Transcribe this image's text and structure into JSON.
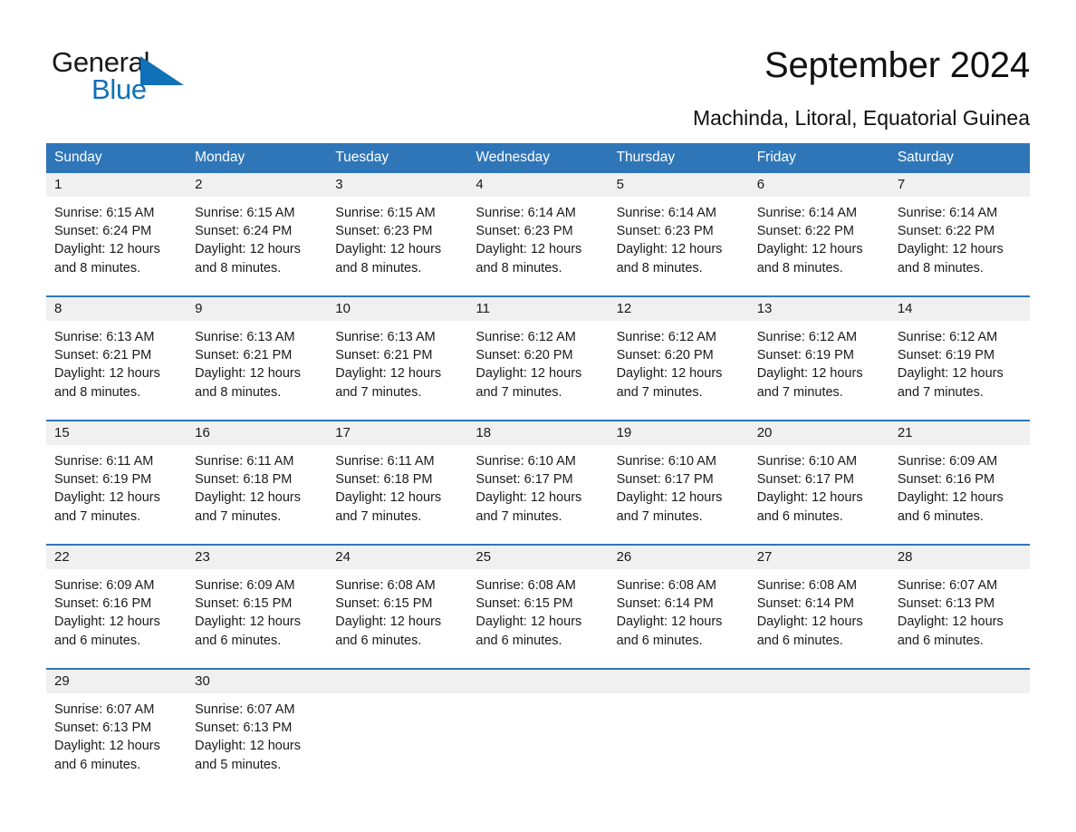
{
  "brand": {
    "name_part1": "General",
    "name_part2": "Blue",
    "logo_icon": "triangle-flag-icon",
    "accent_color": "#1070b8"
  },
  "header": {
    "title": "September 2024",
    "subtitle": "Machinda, Litoral, Equatorial Guinea"
  },
  "colors": {
    "header_blue": "#2f76b8",
    "day_band_gray": "#f0f0f0",
    "text": "#1a1a1a",
    "white": "#ffffff"
  },
  "weekdays": [
    "Sunday",
    "Monday",
    "Tuesday",
    "Wednesday",
    "Thursday",
    "Friday",
    "Saturday"
  ],
  "weeks": [
    {
      "days": [
        {
          "num": "1",
          "info": "Sunrise: 6:15 AM\nSunset: 6:24 PM\nDaylight: 12 hours and 8 minutes."
        },
        {
          "num": "2",
          "info": "Sunrise: 6:15 AM\nSunset: 6:24 PM\nDaylight: 12 hours and 8 minutes."
        },
        {
          "num": "3",
          "info": "Sunrise: 6:15 AM\nSunset: 6:23 PM\nDaylight: 12 hours and 8 minutes."
        },
        {
          "num": "4",
          "info": "Sunrise: 6:14 AM\nSunset: 6:23 PM\nDaylight: 12 hours and 8 minutes."
        },
        {
          "num": "5",
          "info": "Sunrise: 6:14 AM\nSunset: 6:23 PM\nDaylight: 12 hours and 8 minutes."
        },
        {
          "num": "6",
          "info": "Sunrise: 6:14 AM\nSunset: 6:22 PM\nDaylight: 12 hours and 8 minutes."
        },
        {
          "num": "7",
          "info": "Sunrise: 6:14 AM\nSunset: 6:22 PM\nDaylight: 12 hours and 8 minutes."
        }
      ]
    },
    {
      "days": [
        {
          "num": "8",
          "info": "Sunrise: 6:13 AM\nSunset: 6:21 PM\nDaylight: 12 hours and 8 minutes."
        },
        {
          "num": "9",
          "info": "Sunrise: 6:13 AM\nSunset: 6:21 PM\nDaylight: 12 hours and 8 minutes."
        },
        {
          "num": "10",
          "info": "Sunrise: 6:13 AM\nSunset: 6:21 PM\nDaylight: 12 hours and 7 minutes."
        },
        {
          "num": "11",
          "info": "Sunrise: 6:12 AM\nSunset: 6:20 PM\nDaylight: 12 hours and 7 minutes."
        },
        {
          "num": "12",
          "info": "Sunrise: 6:12 AM\nSunset: 6:20 PM\nDaylight: 12 hours and 7 minutes."
        },
        {
          "num": "13",
          "info": "Sunrise: 6:12 AM\nSunset: 6:19 PM\nDaylight: 12 hours and 7 minutes."
        },
        {
          "num": "14",
          "info": "Sunrise: 6:12 AM\nSunset: 6:19 PM\nDaylight: 12 hours and 7 minutes."
        }
      ]
    },
    {
      "days": [
        {
          "num": "15",
          "info": "Sunrise: 6:11 AM\nSunset: 6:19 PM\nDaylight: 12 hours and 7 minutes."
        },
        {
          "num": "16",
          "info": "Sunrise: 6:11 AM\nSunset: 6:18 PM\nDaylight: 12 hours and 7 minutes."
        },
        {
          "num": "17",
          "info": "Sunrise: 6:11 AM\nSunset: 6:18 PM\nDaylight: 12 hours and 7 minutes."
        },
        {
          "num": "18",
          "info": "Sunrise: 6:10 AM\nSunset: 6:17 PM\nDaylight: 12 hours and 7 minutes."
        },
        {
          "num": "19",
          "info": "Sunrise: 6:10 AM\nSunset: 6:17 PM\nDaylight: 12 hours and 7 minutes."
        },
        {
          "num": "20",
          "info": "Sunrise: 6:10 AM\nSunset: 6:17 PM\nDaylight: 12 hours and 6 minutes."
        },
        {
          "num": "21",
          "info": "Sunrise: 6:09 AM\nSunset: 6:16 PM\nDaylight: 12 hours and 6 minutes."
        }
      ]
    },
    {
      "days": [
        {
          "num": "22",
          "info": "Sunrise: 6:09 AM\nSunset: 6:16 PM\nDaylight: 12 hours and 6 minutes."
        },
        {
          "num": "23",
          "info": "Sunrise: 6:09 AM\nSunset: 6:15 PM\nDaylight: 12 hours and 6 minutes."
        },
        {
          "num": "24",
          "info": "Sunrise: 6:08 AM\nSunset: 6:15 PM\nDaylight: 12 hours and 6 minutes."
        },
        {
          "num": "25",
          "info": "Sunrise: 6:08 AM\nSunset: 6:15 PM\nDaylight: 12 hours and 6 minutes."
        },
        {
          "num": "26",
          "info": "Sunrise: 6:08 AM\nSunset: 6:14 PM\nDaylight: 12 hours and 6 minutes."
        },
        {
          "num": "27",
          "info": "Sunrise: 6:08 AM\nSunset: 6:14 PM\nDaylight: 12 hours and 6 minutes."
        },
        {
          "num": "28",
          "info": "Sunrise: 6:07 AM\nSunset: 6:13 PM\nDaylight: 12 hours and 6 minutes."
        }
      ]
    },
    {
      "days": [
        {
          "num": "29",
          "info": "Sunrise: 6:07 AM\nSunset: 6:13 PM\nDaylight: 12 hours and 6 minutes."
        },
        {
          "num": "30",
          "info": "Sunrise: 6:07 AM\nSunset: 6:13 PM\nDaylight: 12 hours and 5 minutes."
        },
        {
          "num": "",
          "info": ""
        },
        {
          "num": "",
          "info": ""
        },
        {
          "num": "",
          "info": ""
        },
        {
          "num": "",
          "info": ""
        },
        {
          "num": "",
          "info": ""
        }
      ]
    }
  ]
}
